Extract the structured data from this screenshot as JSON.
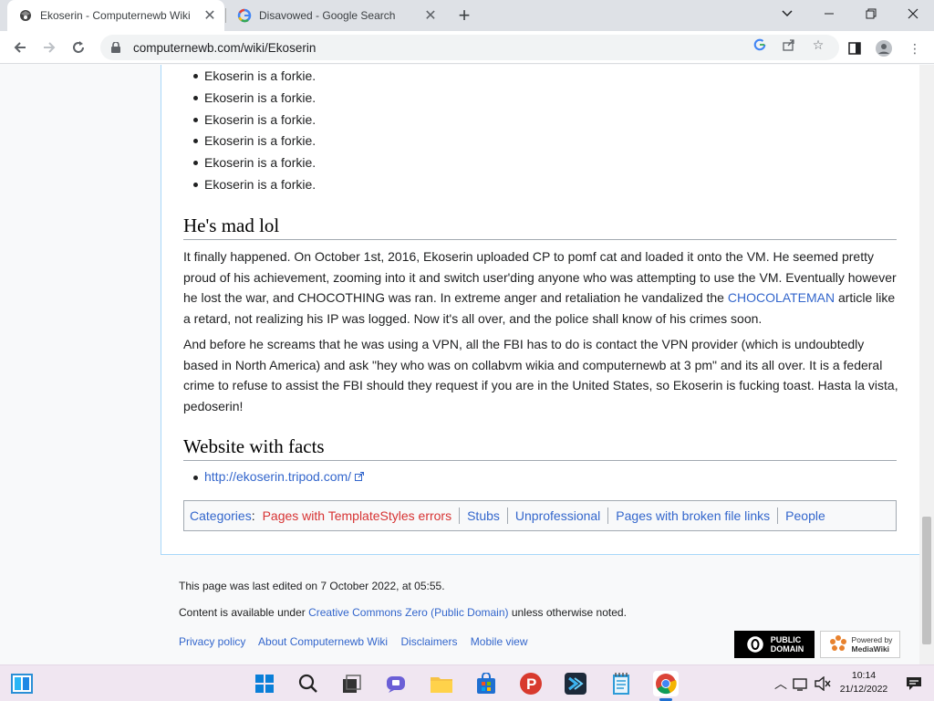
{
  "browser": {
    "tabs": [
      {
        "title": "Ekoserin - Computernewb Wiki",
        "active": true
      },
      {
        "title": "Disavowed - Google Search",
        "active": false
      }
    ],
    "url": "computernewb.com/wiki/Ekoserin"
  },
  "article": {
    "bullets": [
      "Ekoserin is a forkie.",
      "Ekoserin is a forkie.",
      "Ekoserin is a forkie.",
      "Ekoserin is a forkie.",
      "Ekoserin is a forkie.",
      "Ekoserin is a forkie."
    ],
    "section1_heading": "He's mad lol",
    "para1_before": "It finally happened. On October 1st, 2016, Ekoserin uploaded CP to pomf cat and loaded it onto the VM. He seemed pretty proud of his achievement, zooming into it and switch user'ding anyone who was attempting to use the VM. Eventually however he lost the war, and CHOCOTHING was ran. In extreme anger and retaliation he vandalized the ",
    "para1_link": "CHOCOLATEMAN",
    "para1_after": " article like a retard, not realizing his IP was logged. Now it's all over, and the police shall know of his crimes soon.",
    "para2": "And before he screams that he was using a VPN, all the FBI has to do is contact the VPN provider (which is undoubtedly based in North America) and ask \"hey who was on collabvm wikia and computernewb at 3 pm\" and its all over. It is a federal crime to refuse to assist the FBI should they request if you are in the United States, so Ekoserin is fucking toast. Hasta la vista, pedoserin!",
    "section2_heading": "Website with facts",
    "ext_link": "http://ekoserin.tripod.com/",
    "categories_label": "Categories",
    "categories": [
      {
        "label": "Pages with TemplateStyles errors",
        "missing": true
      },
      {
        "label": "Stubs",
        "missing": false
      },
      {
        "label": "Unprofessional",
        "missing": false
      },
      {
        "label": "Pages with broken file links",
        "missing": false
      },
      {
        "label": "People",
        "missing": false
      }
    ]
  },
  "footer": {
    "last_edited": "This page was last edited on 7 October 2022, at 05:55.",
    "license_prefix": "Content is available under ",
    "license_link": "Creative Commons Zero (Public Domain)",
    "license_suffix": " unless otherwise noted.",
    "links": [
      "Privacy policy",
      "About Computernewb Wiki",
      "Disclaimers",
      "Mobile view"
    ],
    "badge_pd": [
      "PUBLIC",
      "DOMAIN"
    ],
    "badge_mw": [
      "Powered by",
      "MediaWiki"
    ]
  },
  "taskbar": {
    "time": "10:14",
    "date": "21/12/2022"
  },
  "colors": {
    "link": "#3366cc",
    "missing_link": "#d73333",
    "content_border": "#a7d7f9"
  }
}
